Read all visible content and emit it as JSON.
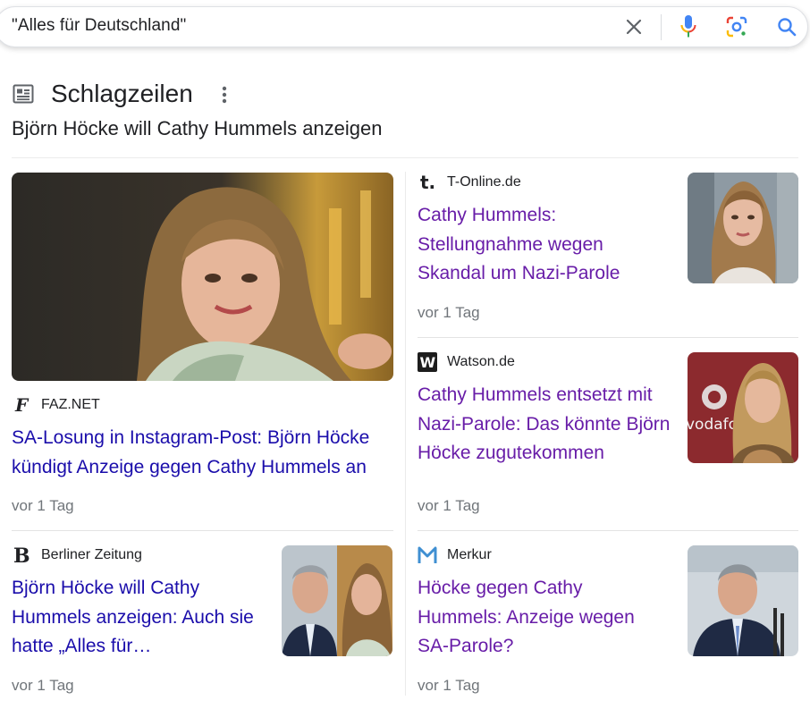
{
  "search": {
    "query": "\"Alles für Deutschland\""
  },
  "icons": {
    "clear": "close-icon",
    "voice": "microphone-icon",
    "lens": "google-lens-icon",
    "search": "search-icon",
    "section": "newspaper-icon",
    "more": "more-vert-icon"
  },
  "colors": {
    "link": "#1a0dab",
    "visited_link": "#681da8",
    "meta": "#70757a",
    "search_blue": "#4285f4"
  },
  "section": {
    "title": "Schlagzeilen",
    "subtitle": "Björn Höcke will Cathy Hummels anzeigen"
  },
  "articles": {
    "faz": {
      "source": "FAZ.NET",
      "headline": "SA-Losung in Instagram-Post: Björn Höcke kündigt Anzeige gegen Cathy Hummels an",
      "age": "vor 1 Tag"
    },
    "tonline": {
      "source": "T-Online.de",
      "headline": "Cathy Hummels: Stellungnahme wegen Skandal um Nazi-Parole",
      "age": "vor 1 Tag"
    },
    "watson": {
      "source": "Watson.de",
      "headline": "Cathy Hummels entsetzt mit Nazi-Parole: Das könnte Björn Höcke zugutekommen",
      "age": "vor 1 Tag",
      "image_text": "vodafo"
    },
    "berliner": {
      "source": "Berliner Zeitung",
      "headline": "Björn Höcke will Cathy Hummels anzeigen: Auch sie hatte „Alles für…",
      "age": "vor 1 Tag"
    },
    "merkur": {
      "source": "Merkur",
      "headline": "Höcke gegen Cathy Hummels: Anzeige wegen SA-Parole?",
      "age": "vor 1 Tag"
    }
  }
}
